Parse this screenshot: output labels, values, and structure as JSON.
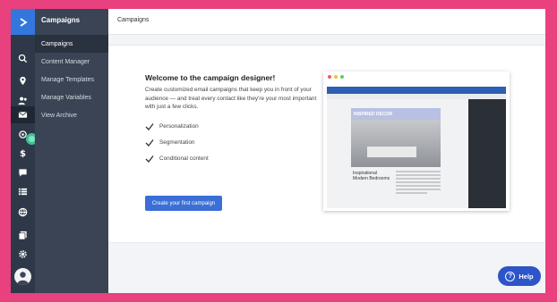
{
  "sidebar": {
    "section_title": "Campaigns",
    "items": [
      {
        "label": "Campaigns",
        "active": true
      },
      {
        "label": "Content Manager"
      },
      {
        "label": "Manage Templates"
      },
      {
        "label": "Manage Variables"
      },
      {
        "label": "View Archive"
      }
    ]
  },
  "rail_icons": [
    "search-icon",
    "location-icon",
    "contacts-icon",
    "mail-icon",
    "automation-icon",
    "dollar-icon",
    "chat-icon",
    "list-icon",
    "globe-icon",
    "pages-icon",
    "gear-icon"
  ],
  "header": {
    "title": "Campaigns"
  },
  "welcome": {
    "title": "Welcome to the campaign designer!",
    "body": "Create customized email campaigns that keep you in front of your audience — and treat every contact like they're your most important with just a few clicks.",
    "features": [
      "Personalization",
      "Segmentation",
      "Conditional content"
    ],
    "cta": "Create your first campaign"
  },
  "preview": {
    "banner": "INSPIRED DECOR",
    "heading": "Inspirational Modern Bedrooms"
  },
  "help": {
    "label": "Help",
    "icon": "?"
  },
  "colors": {
    "accent": "#3a6fd8",
    "rail": "#2e3848",
    "subnav": "#3a4455",
    "logo": "#3377dc",
    "frame": "#e8417e"
  }
}
